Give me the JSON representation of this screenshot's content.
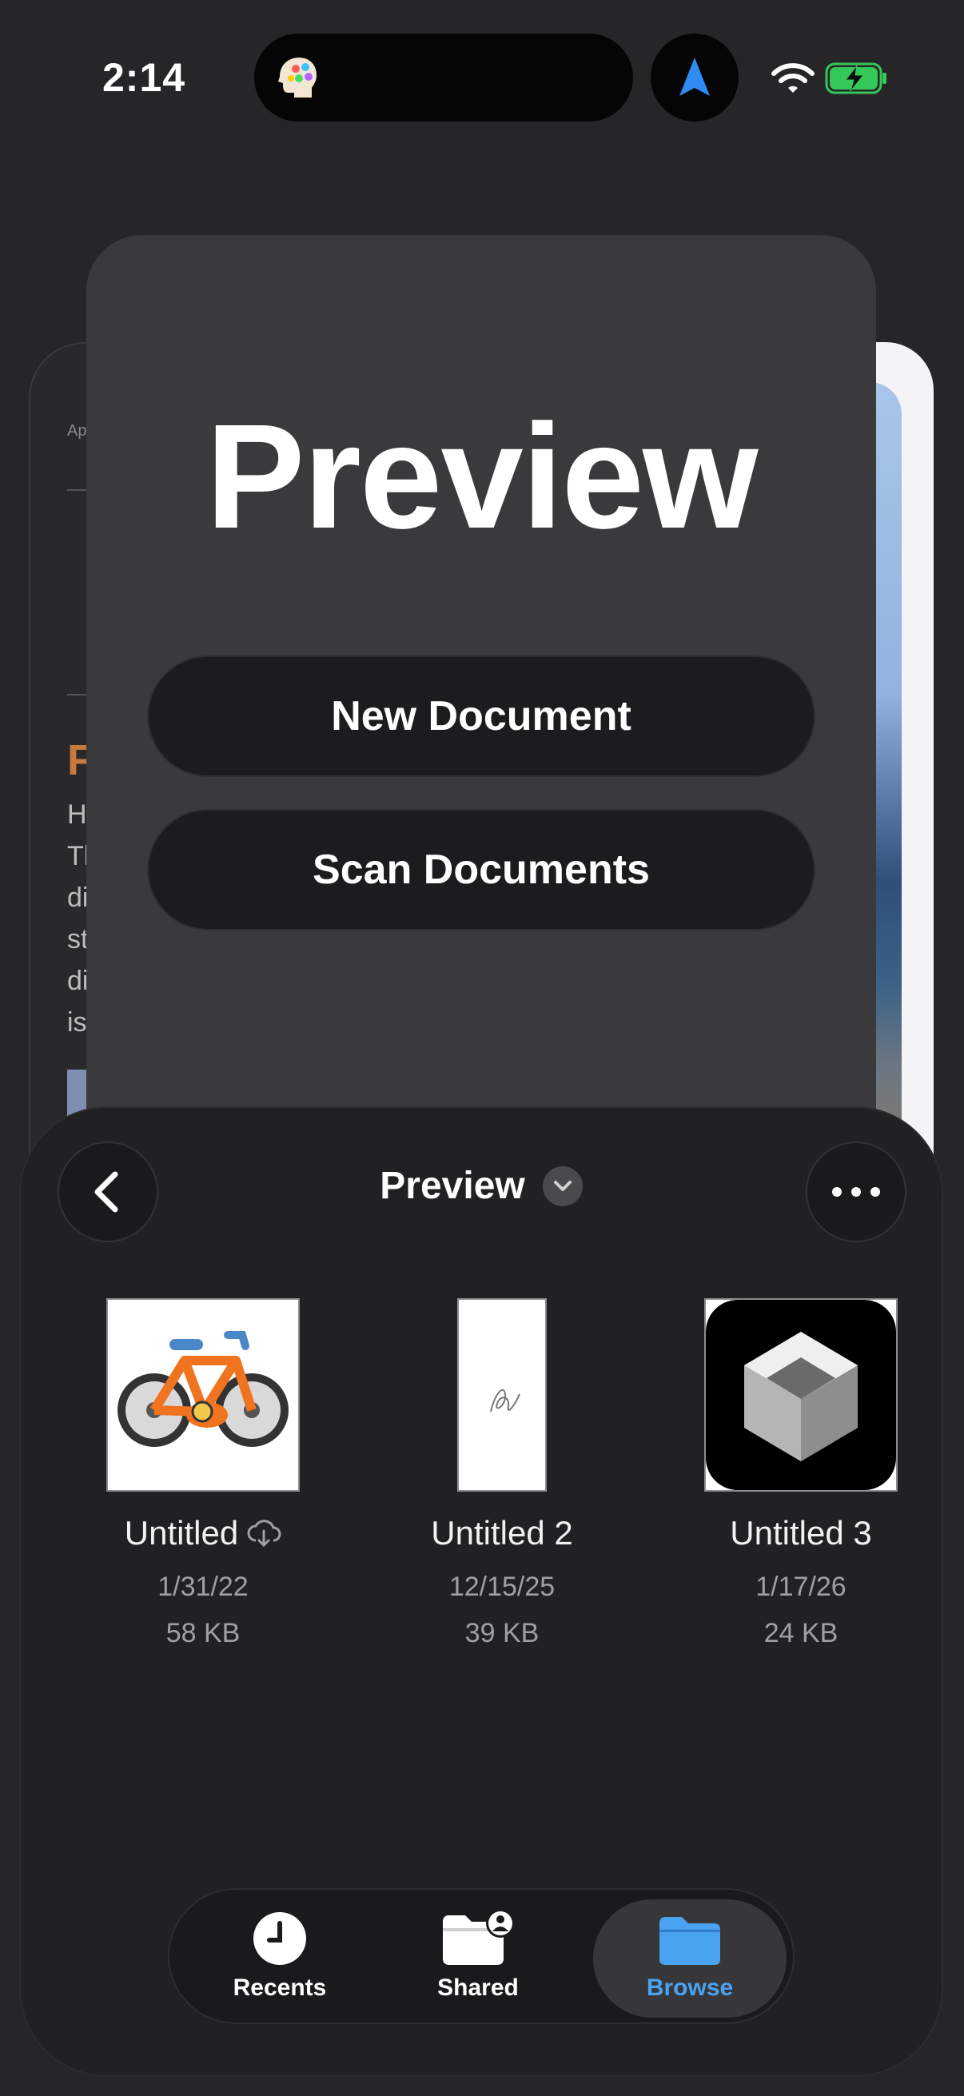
{
  "status_bar": {
    "time": "2:14",
    "island_app_icon": "head-palette-icon",
    "navigation_icon": "location-arrow-icon",
    "wifi_icon": "wifi-icon",
    "battery_icon": "battery-charging-icon"
  },
  "launcher": {
    "title": "Preview",
    "new_document": "New Document",
    "scan_documents": "Scan Documents"
  },
  "background_left": {
    "frag_small": "Ap",
    "frag_heading": "F",
    "lines": [
      "H",
      "Tl",
      "di",
      "st",
      "di",
      "is"
    ]
  },
  "browser": {
    "title": "Preview",
    "back_icon": "chevron-left-icon",
    "more_icon": "ellipsis-icon",
    "files": [
      {
        "name": "Untitled",
        "date": "1/31/22",
        "size": "58 KB",
        "cloud": true
      },
      {
        "name": "Untitled 2",
        "date": "12/15/25",
        "size": "39 KB",
        "cloud": false
      },
      {
        "name": "Untitled 3",
        "date": "1/17/26",
        "size": "24 KB",
        "cloud": false
      }
    ]
  },
  "tabbar": {
    "recents": "Recents",
    "shared": "Shared",
    "browse": "Browse",
    "active": "Browse"
  },
  "colors": {
    "accent": "#4aa3f0",
    "battery_green": "#34c759",
    "navigation_blue": "#2f8cf5"
  }
}
